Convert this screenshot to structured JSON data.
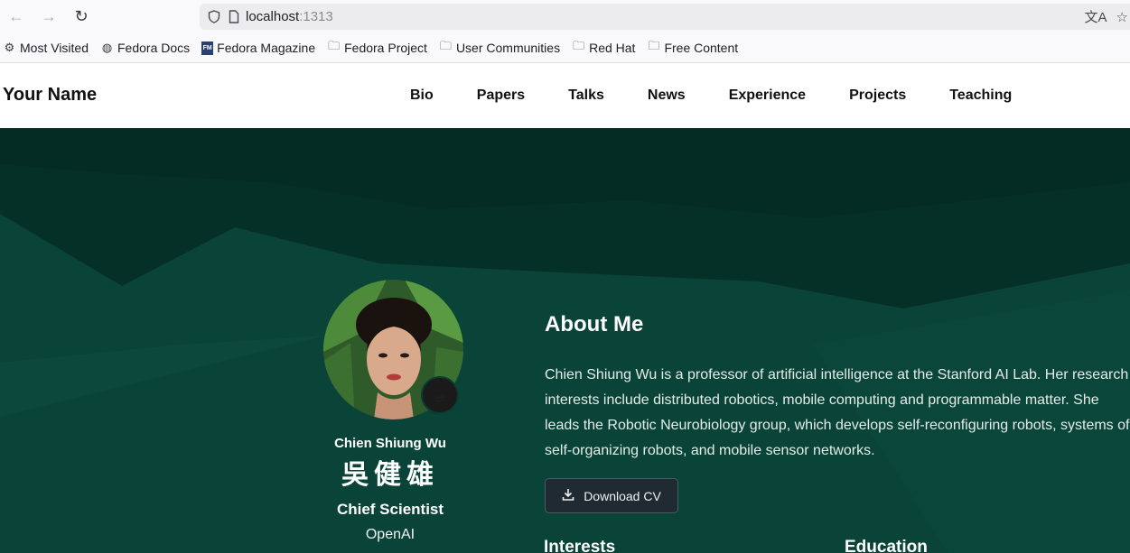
{
  "browser": {
    "url_host": "localhost",
    "url_port": ":1313",
    "back_icon": "arrow-left-icon",
    "forward_icon": "arrow-right-icon",
    "reload_icon": "reload-icon"
  },
  "bookmarks": [
    {
      "label": "Most Visited",
      "icon": "gear-icon"
    },
    {
      "label": "Fedora Docs",
      "icon": "globe-icon"
    },
    {
      "label": "Fedora Magazine",
      "icon": "fedora-magazine-icon"
    },
    {
      "label": "Fedora Project",
      "icon": "folder-icon"
    },
    {
      "label": "User Communities",
      "icon": "folder-icon"
    },
    {
      "label": "Red Hat",
      "icon": "folder-icon"
    },
    {
      "label": "Free Content",
      "icon": "folder-icon"
    }
  ],
  "site": {
    "brand": "Your Name",
    "menu": [
      "Bio",
      "Papers",
      "Talks",
      "News",
      "Experience",
      "Projects",
      "Teaching"
    ]
  },
  "profile": {
    "name": "Chien Shiung Wu",
    "name_cjk": "吳健雄",
    "role": "Chief Scientist",
    "organization": "OpenAI",
    "status_emoji": "☕"
  },
  "about": {
    "heading": "About Me",
    "body": "Chien Shiung Wu is a professor of artificial intelligence at the Stanford AI Lab. Her research interests include distributed robotics, mobile computing and programmable matter. She leads the Robotic Neurobiology group, which develops self-reconfiguring robots, systems of self-organizing robots, and mobile sensor networks.",
    "cv_button": "Download CV",
    "interests_heading": "Interests",
    "education_heading": "Education"
  },
  "colors": {
    "hero_bg": "#0a4438",
    "hero_dark": "#053027",
    "button_bg": "#1f2a33"
  }
}
